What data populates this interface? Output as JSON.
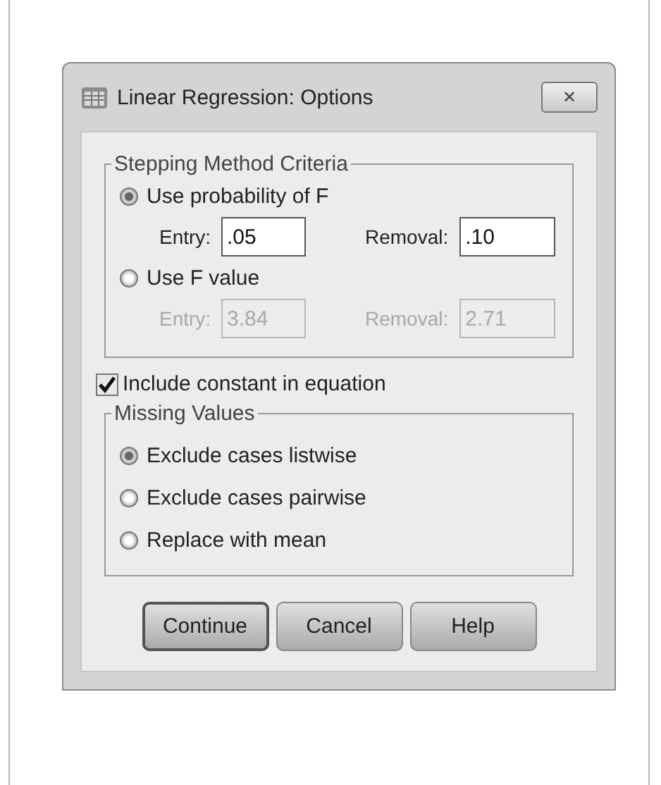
{
  "window": {
    "title": "Linear Regression: Options",
    "close": "✕"
  },
  "stepping": {
    "title": "Stepping Method Criteria",
    "options": [
      {
        "label": "Use probability of F",
        "selected": true,
        "entry_label": "Entry:",
        "entry": ".05",
        "removal_label": "Removal:",
        "removal": ".10",
        "disabled": false
      },
      {
        "label": "Use F value",
        "selected": false,
        "entry_label": "Entry:",
        "entry": "3.84",
        "removal_label": "Removal:",
        "removal": "2.71",
        "disabled": true
      }
    ]
  },
  "include_constant": {
    "label": "Include constant in equation",
    "checked": true
  },
  "missing": {
    "title": "Missing Values",
    "options": [
      {
        "label": "Exclude cases listwise",
        "selected": true
      },
      {
        "label": "Exclude cases pairwise",
        "selected": false
      },
      {
        "label": "Replace with mean",
        "selected": false
      }
    ]
  },
  "buttons": [
    {
      "label": "Continue",
      "default": true
    },
    {
      "label": "Cancel",
      "default": false
    },
    {
      "label": "Help",
      "default": false
    }
  ]
}
